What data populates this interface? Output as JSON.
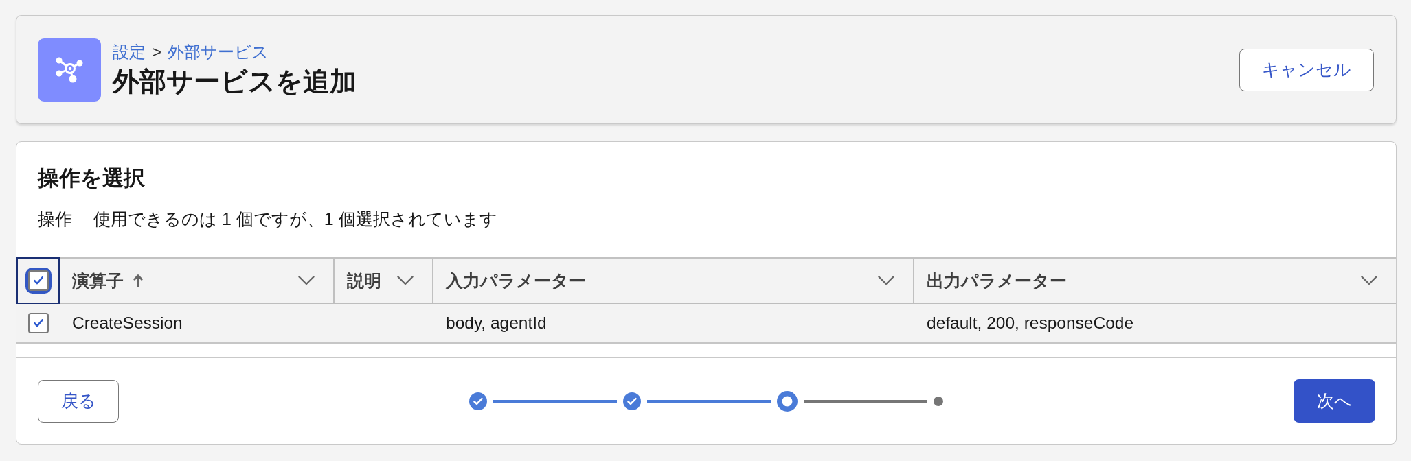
{
  "header": {
    "breadcrumbs": [
      {
        "label": "設定"
      },
      {
        "label": "外部サービス"
      }
    ],
    "breadcrumb_separator": ">",
    "title": "外部サービスを追加",
    "cancel_button": "キャンセル"
  },
  "section": {
    "title": "操作を選択",
    "label": "操作",
    "summary": "使用できるのは 1 個ですが、1 個選択されています"
  },
  "table": {
    "select_all": {
      "checked": true,
      "focused": true
    },
    "columns": [
      {
        "label": "演算子",
        "sorted": true
      },
      {
        "label": "説明",
        "sorted": false
      },
      {
        "label": "入力パラメーター",
        "sorted": false
      },
      {
        "label": "出力パラメーター",
        "sorted": false
      }
    ],
    "rows": [
      {
        "selected": true,
        "operator": "CreateSession",
        "input_parameters": "body, agentId",
        "output_parameters": "default, 200, responseCode"
      }
    ]
  },
  "footer": {
    "back_button": "戻る",
    "steps": [
      {
        "complete": true,
        "current": false
      },
      {
        "complete": true,
        "current": false
      },
      {
        "complete": false,
        "current": true
      },
      {
        "complete": false,
        "current": false
      }
    ],
    "next_button": "次へ"
  }
}
